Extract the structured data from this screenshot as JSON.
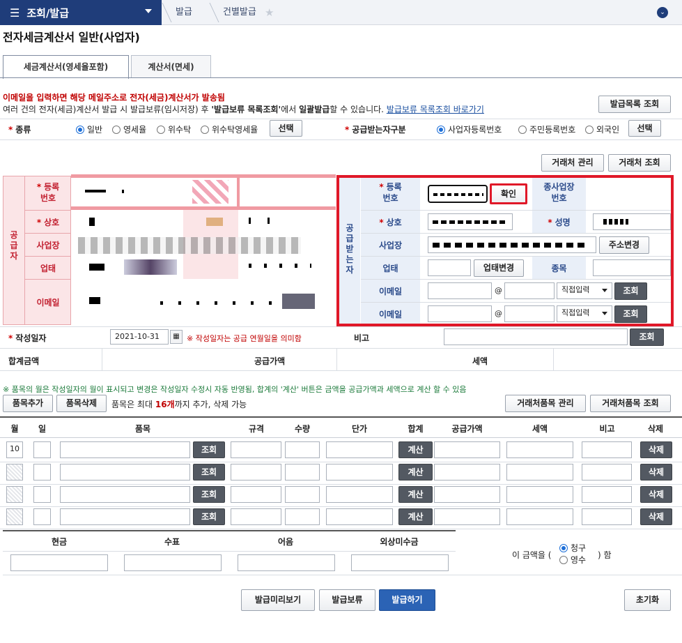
{
  "nav": {
    "menu_label": "조회/발급",
    "crumb1": "발급",
    "crumb2": "건별발급"
  },
  "page_title": "전자세금계산서 일반(사업자)",
  "tabs": [
    {
      "label": "세금계산서(영세율포함)"
    },
    {
      "label": "계산서(면세)"
    }
  ],
  "notice": {
    "line1": "이메일을 입력하면 해당 메일주소로 전자(세금)계산서가 발송됨",
    "line2_a": "여러 건의 전자(세금)계산서 발급 시 발급보류(임시저장) 후 ",
    "line2_b": "'발급보류 목록조회'",
    "line2_c": "에서 ",
    "line2_d": "일괄발급",
    "line2_e": "할 수 있습니다. ",
    "line2_link": "발급보류 목록조회 바로가기"
  },
  "buttons": {
    "issue_list": "발급목록 조회",
    "select": "선택",
    "partner_manage": "거래처 관리",
    "partner_search": "거래처 조회",
    "confirm": "확인",
    "address_change": "주소변경",
    "biz_change": "업태변경",
    "search": "조회",
    "item_add": "품목추가",
    "item_delete": "품목삭제",
    "partner_item_manage": "거래처품목 관리",
    "partner_item_search": "거래처품목 조회",
    "calc": "계산",
    "delete": "삭제",
    "preview": "발급미리보기",
    "hold": "발급보류",
    "issue": "발급하기",
    "reset": "초기화"
  },
  "type_row": {
    "label": "종류",
    "options": [
      "일반",
      "영세율",
      "위수탁",
      "위수탁영세율"
    ],
    "selected": "일반",
    "recv_label": "공급받는자구분",
    "recv_options": [
      "사업자등록번호",
      "주민등록번호",
      "외국인"
    ],
    "recv_selected": "사업자등록번호"
  },
  "supplier": {
    "side_label": "공급자",
    "fields": [
      "등록\n번호",
      "상호",
      "사업장",
      "업태",
      "이메일"
    ]
  },
  "receiver": {
    "side_label": "공급받는자",
    "reg_label": "등록\n번호",
    "sub_label": "종사업장\n번호",
    "name_label": "상호",
    "ceo_label": "성명",
    "addr_label": "사업장",
    "biz_label": "업태",
    "item_label": "종목",
    "email_label": "이메일",
    "at": "@",
    "domain_select": "직접입력"
  },
  "date_row": {
    "label": "작성일자",
    "value": "2021-10-31",
    "note": "※ 작성일자는 공급 연월일을 의미함",
    "remark_label": "비고"
  },
  "sum_row": {
    "total": "합계금액",
    "supply": "공급가액",
    "tax": "세액"
  },
  "items_note": "※ 품목의 월은 작성일자의 월이 표시되고 변경은 작성일자 수정시 자동 반영됨, 합계의 '계산' 버튼은 금액을 공급가액과 세액으로 계산 할 수 있음",
  "items_limit": {
    "a": "품목은 최대 ",
    "b": "16개",
    "c": "까지 추가, 삭제 가능"
  },
  "items_headers": [
    "월",
    "일",
    "품목",
    "규격",
    "수량",
    "단가",
    "합계",
    "공급가액",
    "세액",
    "비고",
    "삭제"
  ],
  "item_rows": [
    {
      "month": "10"
    },
    {
      "month": ""
    },
    {
      "month": ""
    },
    {
      "month": ""
    }
  ],
  "payment": {
    "headers": [
      "현금",
      "수표",
      "어음",
      "외상미수금"
    ],
    "text_a": "이 금액을 (",
    "text_b": ") 함",
    "opts": [
      "청구",
      "영수"
    ],
    "selected": "청구"
  }
}
